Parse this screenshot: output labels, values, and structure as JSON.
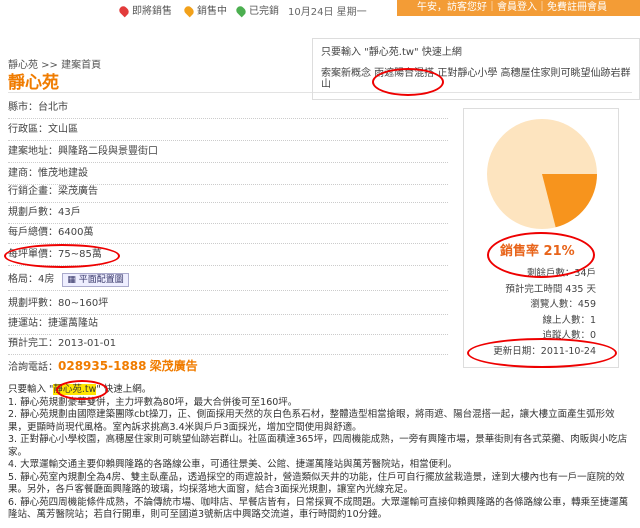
{
  "topbar": {
    "legend": [
      {
        "label": "即將銷售",
        "color": "#e23b3b"
      },
      {
        "label": "銷售中",
        "color": "#f2a11a"
      },
      {
        "label": "已完銷",
        "color": "#4caf50"
      }
    ],
    "date": "10月24日 星期一",
    "account_text": "午安，訪客您好｜會員登入｜免費註冊會員"
  },
  "breadcrumb": "靜心苑 >> 建案首頁",
  "title": "靜心苑",
  "notice": {
    "line1": "只要輸入 \"靜心苑.tw\" 快速上網",
    "line2": "索案新概念 雨遮陽台混搭 正對靜心小學 高穗屋住家則可眺望仙跡岩群山"
  },
  "details": [
    {
      "label": "縣市：",
      "value": "台北市"
    },
    {
      "label": "行政區：",
      "value": "文山區"
    },
    {
      "label": "建案地址：",
      "value": "興隆路二段與景豐街口"
    },
    {
      "label": "建商：",
      "value": "惟茂地建設"
    },
    {
      "label": "行銷企畫：",
      "value": "梁茂廣告"
    },
    {
      "label": "規劃戶數：",
      "value": "43戶"
    },
    {
      "label": "每戶總價：",
      "value": "6400萬"
    },
    {
      "label": "每坪單價：",
      "value": "75~85萬"
    },
    {
      "label": "格局：",
      "value": "4房"
    },
    {
      "label": "規劃坪數：",
      "value": "80~160坪"
    },
    {
      "label": "捷運站：",
      "value": "捷運萬隆站"
    },
    {
      "label": "預計完工：",
      "value": "2013-01-01"
    }
  ],
  "floor_plan_button": "平面配置圖",
  "contact": {
    "label": "洽詢電話：",
    "phone": "028935-1888",
    "agency": "梁茂廣告"
  },
  "sales": {
    "rate_fraction": 0.21,
    "rate_label": "銷售率 21%",
    "colors": {
      "sold": "#f7941d",
      "unsold": "#fde4bf"
    },
    "lines": [
      "剩餘戶數：34戶",
      "預計完工時間 435 天",
      "瀏覽人數：459",
      "線上人數：1",
      "追蹤人數：0",
      "更新日期：2011-10-24"
    ]
  },
  "intro": {
    "lead": "只要輸入 \"",
    "keyword": "靜心苑.tw",
    "lead_end": "\" 快速上網。",
    "items": [
      "1. 靜心苑規劃豪華雙併，主力坪數為80坪，最大合併後可至160坪。",
      "2. 靜心苑規劃由國際建築團隊cbt操刀，正、側面採用天然的灰白色系石材，整體造型相當搶眼，將雨遮、陽台混搭一起，讓大樓立面產生弧形效果，更顯時尚現代風格。室內訴求挑高3.4米與戶戶3面採光，增加空間使用與舒適。",
      "3. 正對靜心小學校園，高穗屋住家則可眺望仙跡岩群山。社區面積達365坪，四周機能成熟，一旁有興隆市場，景華街則有各式菜攤、肉販與小吃店家。",
      "4. 大眾運輸交通主要仰賴興隆路的各路線公車，可通往景美、公館、捷運萬隆站與萬芳醫院站，相當便利。",
      "5. 靜心苑室內規劃全為4房、雙主臥產品，透過採空的雨遮設計，營造類似天井的功能，住戶可自行擺放盆栽造景，達到大樓內也有一戶一庭院的效果。另外，各戶客餐廳面興隆路的玻璃，均採落地大面窗，結合3面採光規劃，讓室內光線充足。",
      "6. 靜心苑四周機能條件成熟，不論傳統市場、咖啡店、早餐店皆有，日常採買不成問題。大眾運輸可直接仰賴興隆路的各條路線公車，轉乘至捷運萬隆站、萬芳醫院站；若自行開車，則可至國道3號新店中興路交流道，車行時間約10分鐘。"
    ]
  }
}
